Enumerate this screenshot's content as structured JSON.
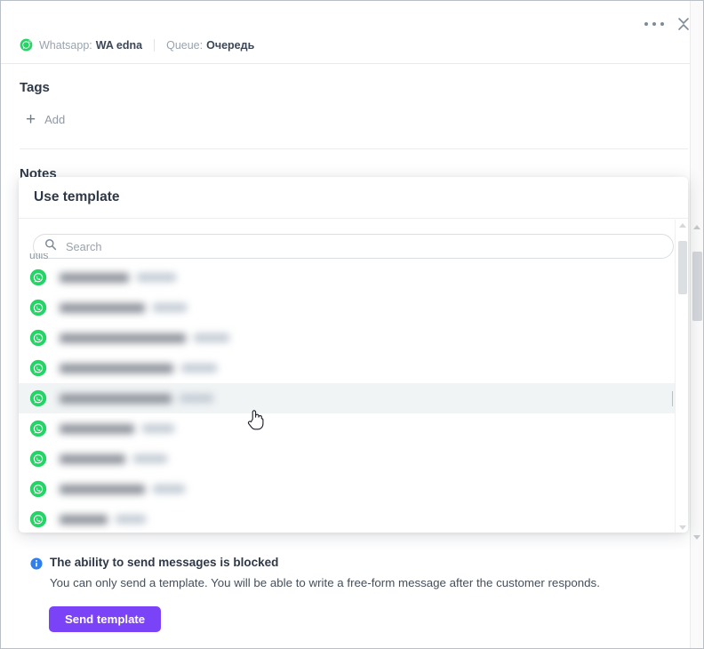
{
  "window": {
    "more_actions_label": "•••",
    "collapse_label": "collapse"
  },
  "header": {
    "channel_label": "Whatsapp:",
    "channel_value": "WA edna",
    "queue_label": "Queue:",
    "queue_value": "Очередь",
    "channel_icon": "whatsapp-icon"
  },
  "tags": {
    "title": "Tags",
    "add_label": "Add",
    "add_icon": "plus-icon"
  },
  "notes": {
    "title": "Notes"
  },
  "modal": {
    "title": "Use template",
    "search": {
      "placeholder": "Search",
      "value": "",
      "icon": "search-icon"
    },
    "clipped_group_label": "utils",
    "rows": [
      {
        "icon": "whatsapp-icon",
        "name_w": 78,
        "tag_w": 44,
        "hovered": false
      },
      {
        "icon": "whatsapp-icon",
        "name_w": 96,
        "tag_w": 38,
        "hovered": false
      },
      {
        "icon": "whatsapp-icon",
        "name_w": 142,
        "tag_w": 40,
        "hovered": false
      },
      {
        "icon": "whatsapp-icon",
        "name_w": 128,
        "tag_w": 40,
        "hovered": false
      },
      {
        "icon": "whatsapp-icon",
        "name_w": 126,
        "tag_w": 38,
        "hovered": true
      },
      {
        "icon": "whatsapp-icon",
        "name_w": 84,
        "tag_w": 36,
        "hovered": false
      },
      {
        "icon": "whatsapp-icon",
        "name_w": 74,
        "tag_w": 38,
        "hovered": false
      },
      {
        "icon": "whatsapp-icon",
        "name_w": 96,
        "tag_w": 36,
        "hovered": false
      },
      {
        "icon": "whatsapp-icon",
        "name_w": 54,
        "tag_w": 34,
        "hovered": false
      }
    ]
  },
  "notice": {
    "icon": "info-icon",
    "title": "The ability to send messages is blocked",
    "description": "You can only send a template. You will be able to write a free-form message after the customer responds.",
    "send_button": "Send template"
  },
  "colors": {
    "accent_purple": "#7b43f7",
    "whatsapp_green": "#25d366",
    "info_blue": "#2f80ed",
    "text_dark": "#2f3846",
    "text_muted": "#9aa3ad"
  }
}
